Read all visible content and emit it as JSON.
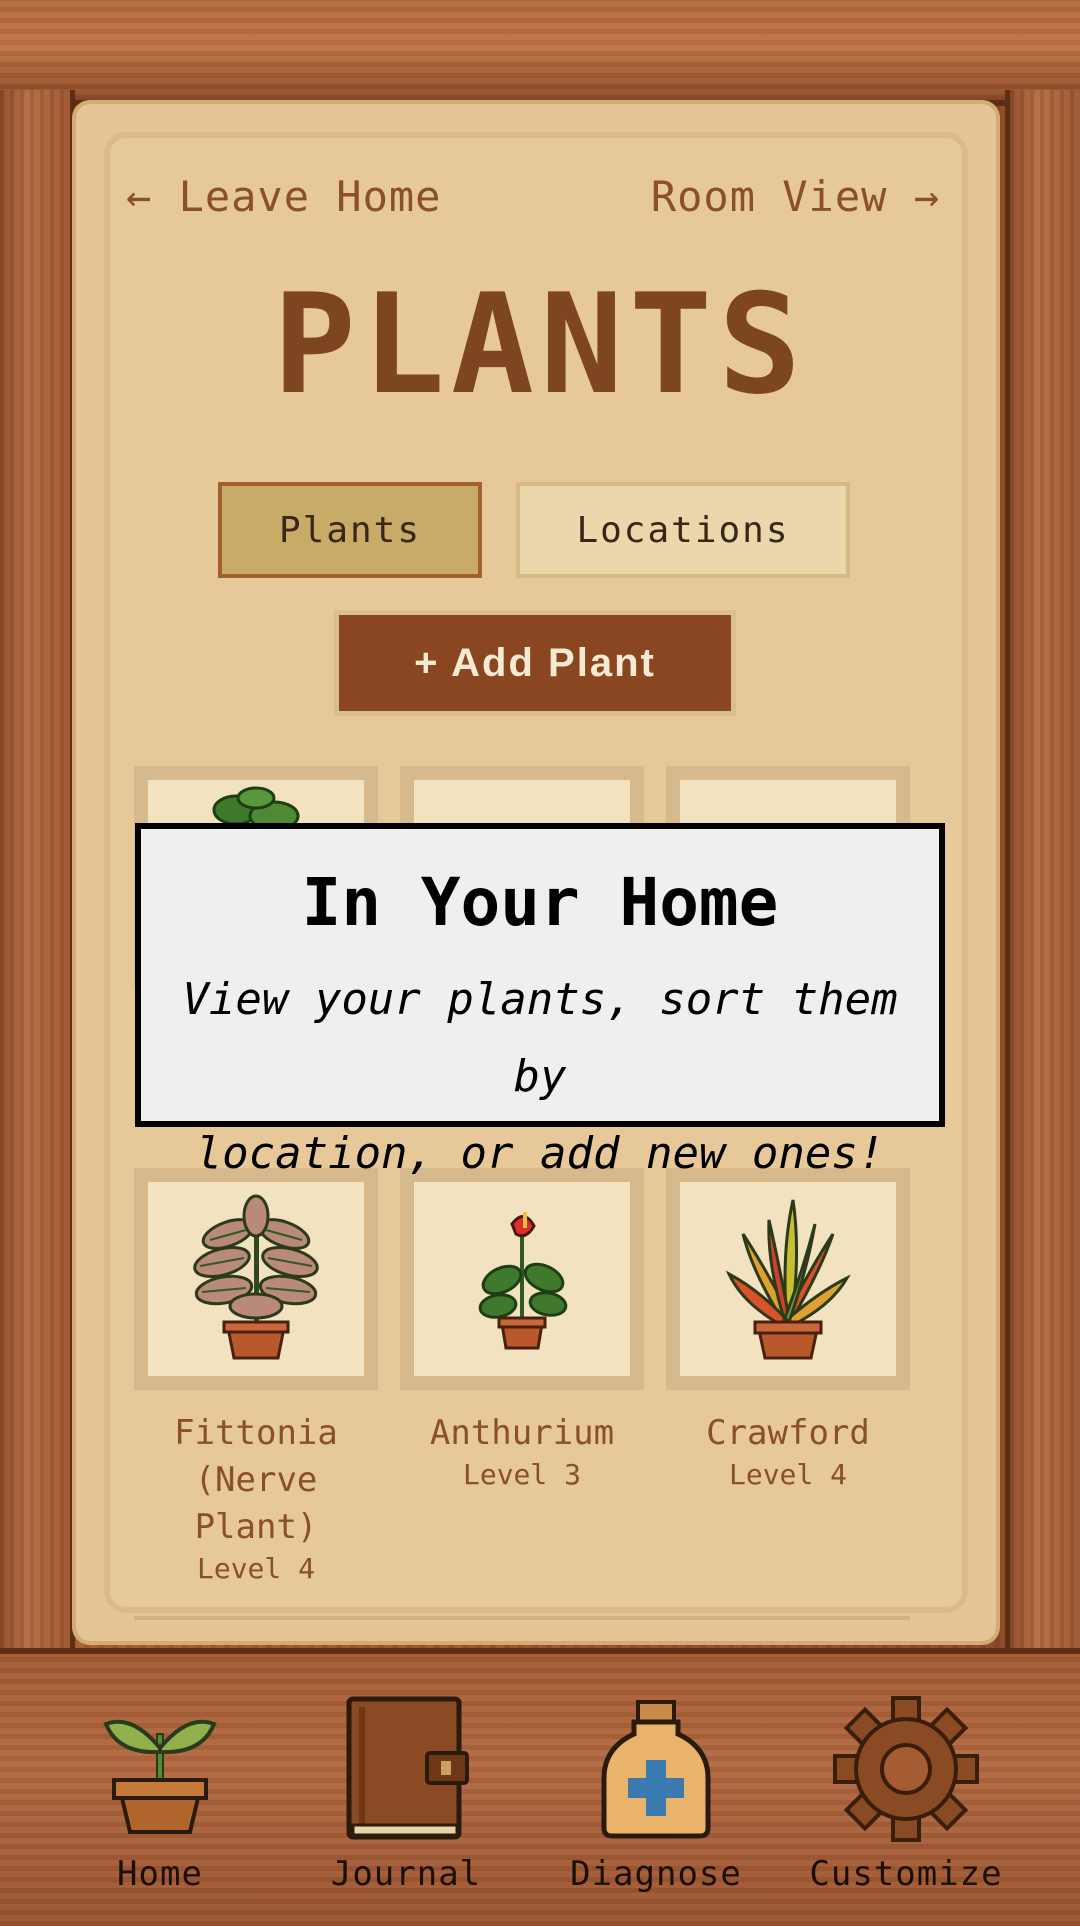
{
  "header": {
    "leave_home": "← Leave Home",
    "room_view": "Room View →",
    "title": "PLANTS"
  },
  "tabs": [
    {
      "label": "Plants",
      "active": true
    },
    {
      "label": "Locations",
      "active": false
    }
  ],
  "add_plant_label": "+ Add Plant",
  "tooltip": {
    "title": "In Your Home",
    "body_line1": "View your plants, sort them by",
    "body_line2": "location, or add new ones!"
  },
  "plants": [
    {
      "name_lines": [
        "Fittonia",
        "(Nerve",
        "Plant)"
      ],
      "level": "Level 4",
      "icon": "fittonia-plant-icon"
    },
    {
      "name_lines": [
        "Anthurium"
      ],
      "level": "Level 3",
      "icon": "anthurium-plant-icon"
    },
    {
      "name_lines": [
        "Crawford"
      ],
      "level": "Level 4",
      "icon": "croton-plant-icon"
    }
  ],
  "bottom_nav": [
    {
      "label": "Home",
      "icon": "sprout-pot-icon"
    },
    {
      "label": "Journal",
      "icon": "journal-book-icon"
    },
    {
      "label": "Diagnose",
      "icon": "medicine-bottle-icon"
    },
    {
      "label": "Customize",
      "icon": "gear-icon"
    }
  ],
  "colors": {
    "wood": "#a65c33",
    "parchment": "#e7c898",
    "text_brown": "#8a5026",
    "button_brown": "#8a4620",
    "tab_active": "#c9ab68",
    "tab_inactive": "#ead7ac",
    "tooltip_bg": "#efefef"
  }
}
